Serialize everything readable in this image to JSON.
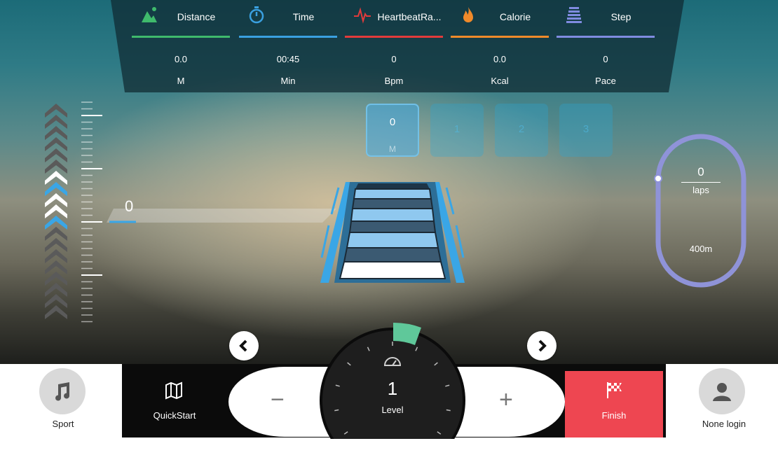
{
  "stats": [
    {
      "icon": "distance-icon",
      "label": "Distance",
      "value": "0.0",
      "unit": "M",
      "color": "#3fba6c"
    },
    {
      "icon": "timer-icon",
      "label": "Time",
      "value": "00:45",
      "unit": "Min",
      "color": "#3aa0e0"
    },
    {
      "icon": "heartbeat-icon",
      "label": "HeartbeatRa...",
      "value": "0",
      "unit": "Bpm",
      "color": "#e23b3b"
    },
    {
      "icon": "flame-icon",
      "label": "Calorie",
      "value": "0.0",
      "unit": "Kcal",
      "color": "#f08a2a"
    },
    {
      "icon": "stairs-icon",
      "label": "Step",
      "value": "0",
      "unit": "Pace",
      "color": "#7f8be0"
    }
  ],
  "segments": [
    {
      "label": "0",
      "unit": "M",
      "active": true
    },
    {
      "label": "1"
    },
    {
      "label": "2"
    },
    {
      "label": "3"
    }
  ],
  "height_value": "0",
  "track": {
    "laps": "0",
    "laps_unit": "laps",
    "distance": "400m"
  },
  "controls": {
    "sport": "Sport",
    "quickstart": "QuickStart",
    "minus": "−",
    "plus": "+",
    "level": "1",
    "level_label": "Level",
    "finish": "Finish",
    "login": "None login"
  },
  "colors": {
    "accent_blue": "#3aa6e6",
    "finish_red": "#ee4651",
    "track_purple": "#8f93d8",
    "level_green": "#5fc89a"
  }
}
